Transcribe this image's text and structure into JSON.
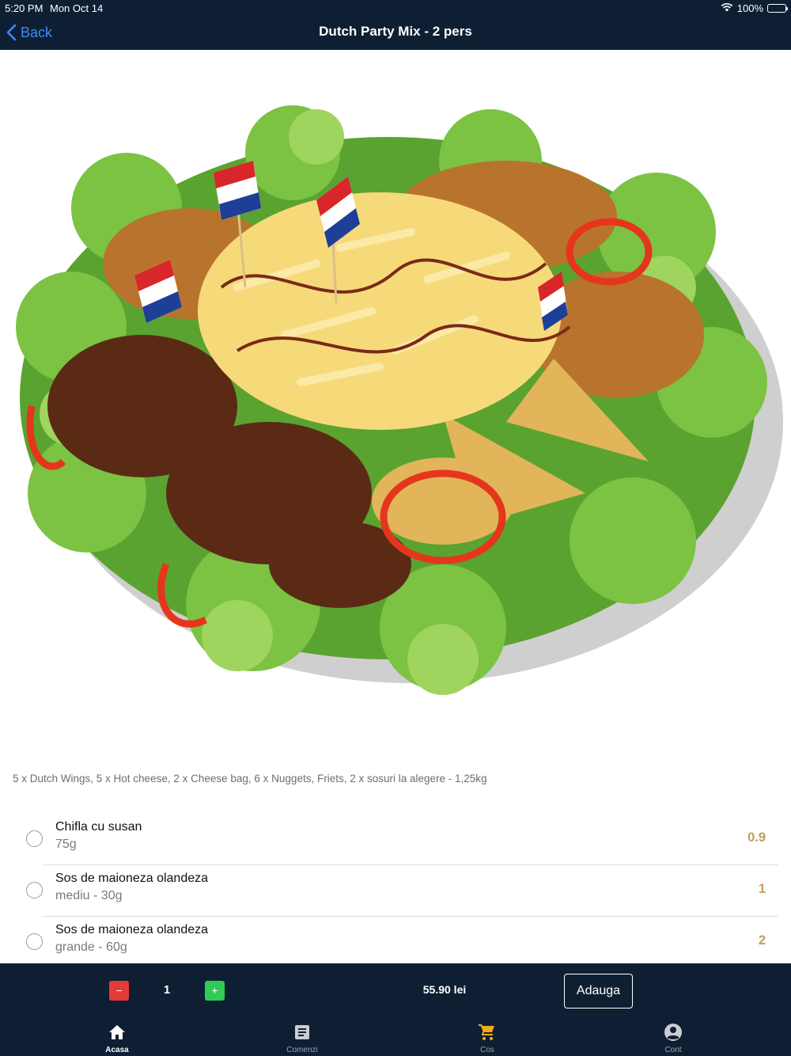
{
  "status_bar": {
    "time": "5:20 PM",
    "date": "Mon Oct 14",
    "battery": "100%",
    "icons": [
      "wifi-icon",
      "battery-icon"
    ]
  },
  "nav": {
    "back_label": "Back",
    "title": "Dutch Party Mix - 2 pers"
  },
  "product": {
    "image": "food-platter-image",
    "description": "5 x Dutch Wings, 5 x Hot cheese, 2 x Cheese bag, 6 x Nuggets, Friets, 2 x sosuri la alegere - 1,25kg"
  },
  "options": [
    {
      "name": "Chifla cu susan",
      "detail": "75g",
      "price": "0.9"
    },
    {
      "name": "Sos de maioneza olandeza",
      "detail": "mediu - 30g",
      "price": "1"
    },
    {
      "name": "Sos de maioneza olandeza",
      "detail": "grande - 60g",
      "price": "2"
    }
  ],
  "cart": {
    "minus_label": "−",
    "quantity": "1",
    "plus_label": "+",
    "total": "55.90 lei",
    "add_label": "Adauga"
  },
  "tabs": [
    {
      "label": "Acasa",
      "icon": "home-icon",
      "active": true
    },
    {
      "label": "Comenzi",
      "icon": "orders-icon",
      "active": false
    },
    {
      "label": "Cos",
      "icon": "cart-icon",
      "active": false
    },
    {
      "label": "Cont",
      "icon": "account-icon",
      "active": false
    }
  ],
  "colors": {
    "navy": "#0f1f33",
    "accent_blue": "#3d8cf4",
    "price_gold": "#c29d5b",
    "minus_red": "#e53a3a",
    "plus_green": "#2ecc57",
    "cart_yellow": "#f4a91a"
  }
}
